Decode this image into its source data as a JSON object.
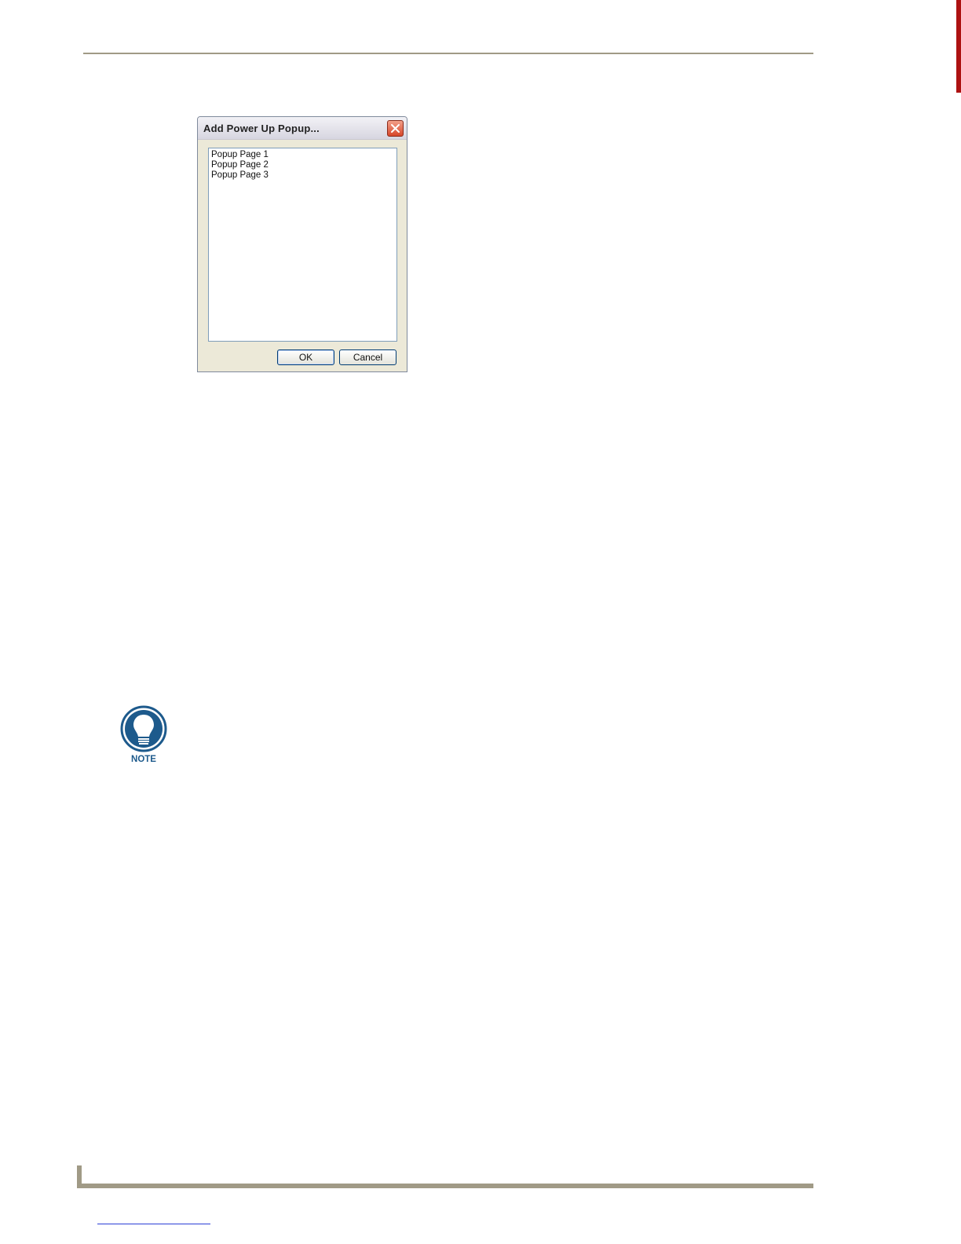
{
  "dialog": {
    "title": "Add Power Up Popup...",
    "items": [
      "Popup Page 1",
      "Popup Page 2",
      "Popup Page 3"
    ],
    "ok_label": "OK",
    "cancel_label": "Cancel"
  },
  "note": {
    "label": "NOTE",
    "icon": "lightbulb-icon"
  },
  "colors": {
    "rule": "#a09a86",
    "tab": "#ad1212",
    "note_blue": "#1d5a8c"
  }
}
